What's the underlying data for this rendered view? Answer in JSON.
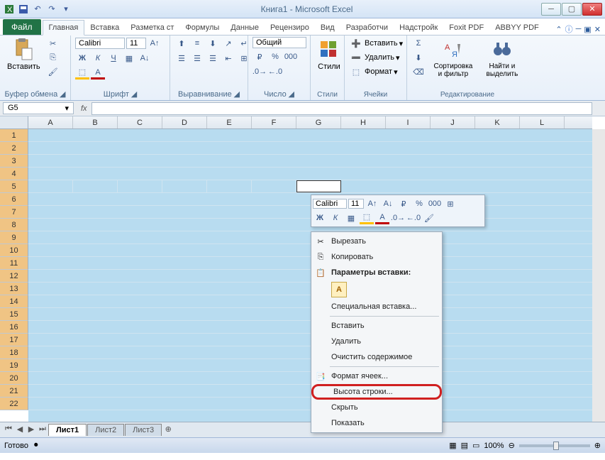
{
  "title": "Книга1  -  Microsoft Excel",
  "tabs": {
    "file": "Файл",
    "items": [
      "Главная",
      "Вставка",
      "Разметка ст",
      "Формулы",
      "Данные",
      "Рецензиро",
      "Вид",
      "Разработчи",
      "Надстройк",
      "Foxit PDF",
      "ABBYY PDF"
    ],
    "active": 0
  },
  "ribbon": {
    "clipboard": {
      "label": "Буфер обмена",
      "paste": "Вставить"
    },
    "font": {
      "label": "Шрифт",
      "name": "Calibri",
      "size": "11"
    },
    "alignment": {
      "label": "Выравнивание"
    },
    "number": {
      "label": "Число",
      "format": "Общий"
    },
    "styles": {
      "label": "Стили",
      "styles_btn": "Стили"
    },
    "cells": {
      "label": "Ячейки",
      "insert": "Вставить",
      "delete": "Удалить",
      "format": "Формат"
    },
    "editing": {
      "label": "Редактирование",
      "sort": "Сортировка и фильтр",
      "find": "Найти и выделить"
    }
  },
  "namebox": "G5",
  "columns": [
    "A",
    "B",
    "C",
    "D",
    "E",
    "F",
    "G",
    "H",
    "I",
    "J",
    "K",
    "L"
  ],
  "rows": [
    "1",
    "2",
    "3",
    "4",
    "5",
    "6",
    "7",
    "8",
    "9",
    "10",
    "11",
    "12",
    "13",
    "14",
    "15",
    "16",
    "17",
    "18",
    "19",
    "20",
    "21",
    "22"
  ],
  "minitoolbar": {
    "font": "Calibri",
    "size": "11"
  },
  "context": {
    "cut": "Вырезать",
    "copy": "Копировать",
    "paste_opts": "Параметры вставки:",
    "paste_special": "Специальная вставка...",
    "insert": "Вставить",
    "delete": "Удалить",
    "clear": "Очистить содержимое",
    "format_cells": "Формат ячеек...",
    "row_height": "Высота строки...",
    "hide": "Скрыть",
    "show": "Показать"
  },
  "sheets": [
    "Лист1",
    "Лист2",
    "Лист3"
  ],
  "status": {
    "ready": "Готово",
    "zoom": "100%"
  }
}
